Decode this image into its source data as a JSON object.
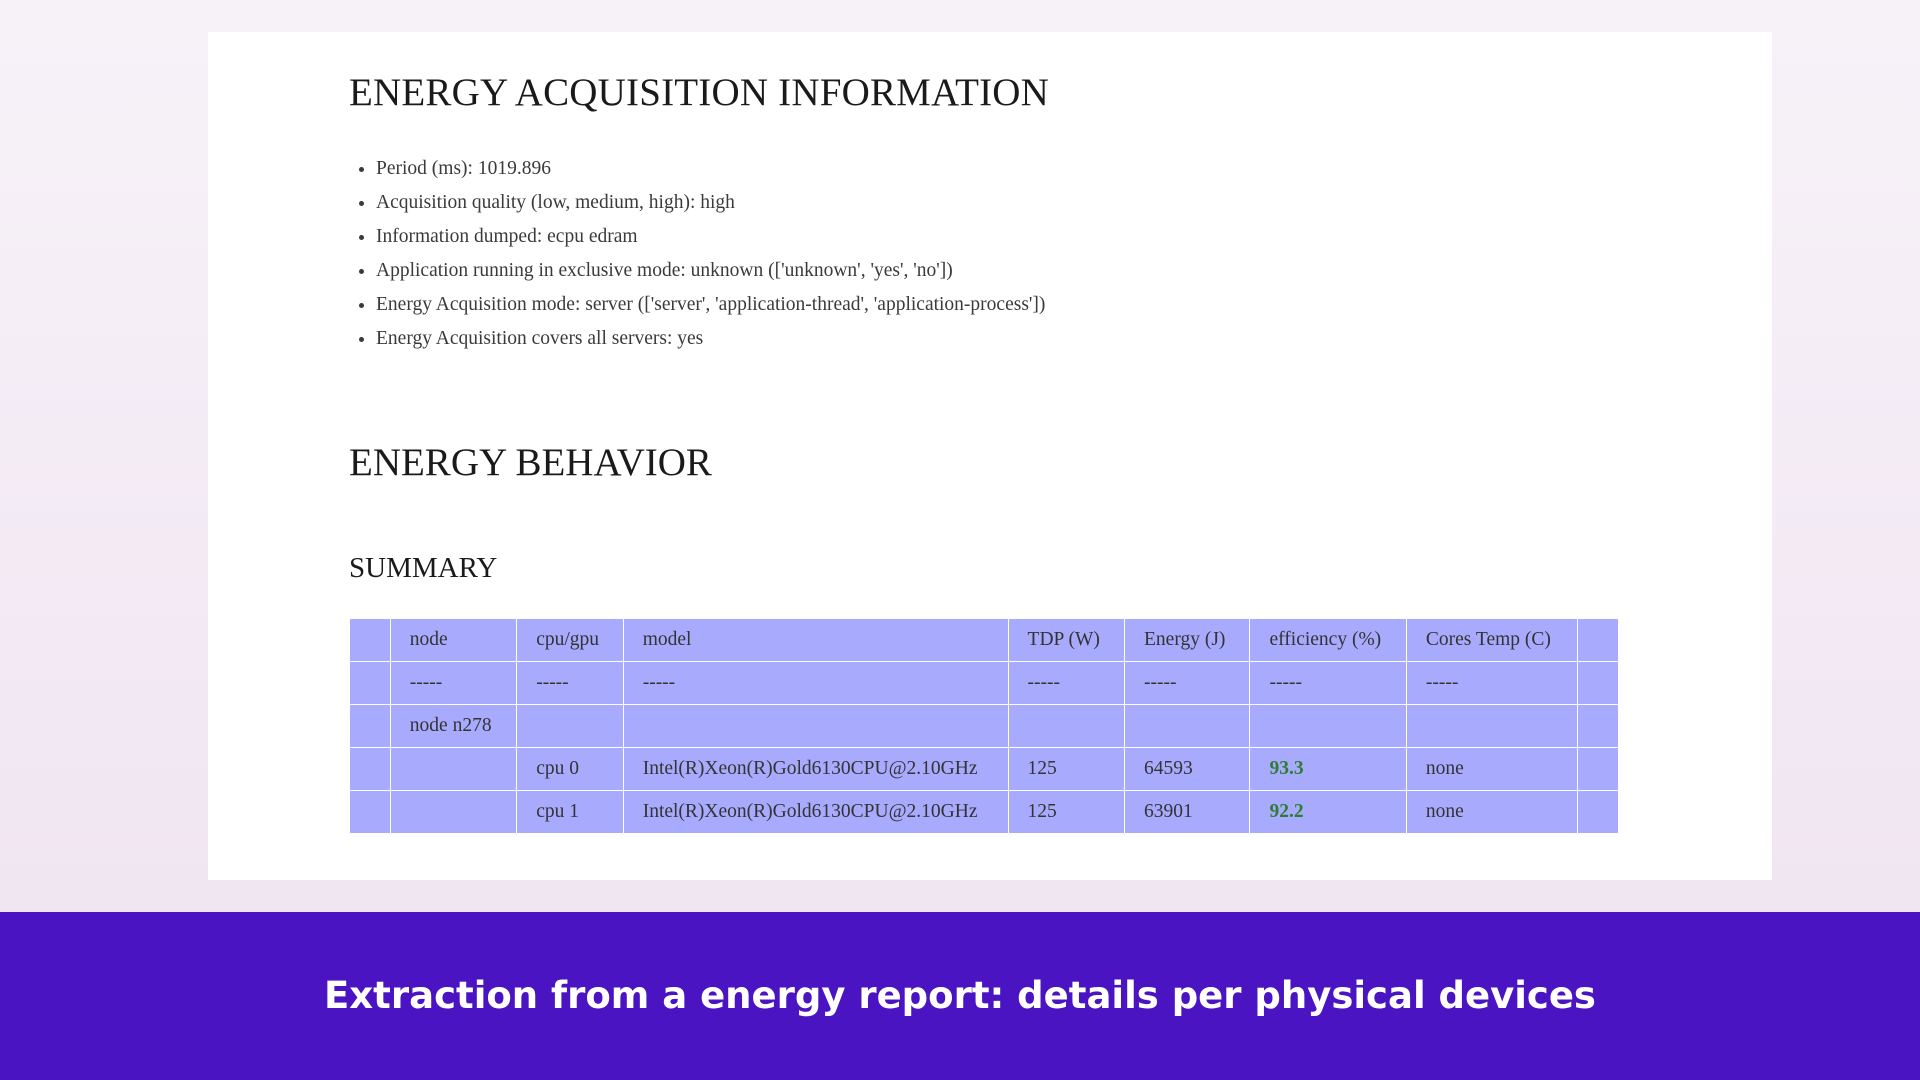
{
  "acquisition": {
    "title": "ENERGY ACQUISITION INFORMATION",
    "items": [
      "Period (ms): 1019.896",
      "Acquisition quality (low, medium, high): high",
      "Information dumped: ecpu edram",
      "Application running in exclusive mode: unknown (['unknown', 'yes', 'no'])",
      "Energy Acquisition mode: server (['server', 'application-thread', 'application-process'])",
      "Energy Acquisition covers all servers: yes"
    ]
  },
  "behavior": {
    "title": "ENERGY BEHAVIOR",
    "summary_title": "SUMMARY"
  },
  "summary_table": {
    "headers": [
      "",
      "node",
      "cpu/gpu",
      "model",
      "TDP (W)",
      "Energy (J)",
      "efficiency (%)",
      "Cores Temp (C)",
      ""
    ],
    "separator": [
      "",
      "-----",
      "-----",
      "-----",
      "-----",
      "-----",
      "-----",
      "-----",
      ""
    ],
    "rows": [
      [
        "",
        "node n278",
        "",
        "",
        "",
        "",
        "",
        "",
        ""
      ],
      [
        "",
        "",
        "cpu 0",
        "Intel(R)Xeon(R)Gold6130CPU@2.10GHz",
        "125",
        "64593",
        "93.3",
        "none",
        ""
      ],
      [
        "",
        "",
        "cpu 1",
        "Intel(R)Xeon(R)Gold6130CPU@2.10GHz",
        "125",
        "63901",
        "92.2",
        "none",
        ""
      ]
    ],
    "colors": {
      "table_background": "#a8aafd",
      "efficiency_value": "#2e7d32"
    }
  },
  "banner": {
    "text": "Extraction from a energy report: details per physical devices",
    "background": "#4b14c2"
  }
}
